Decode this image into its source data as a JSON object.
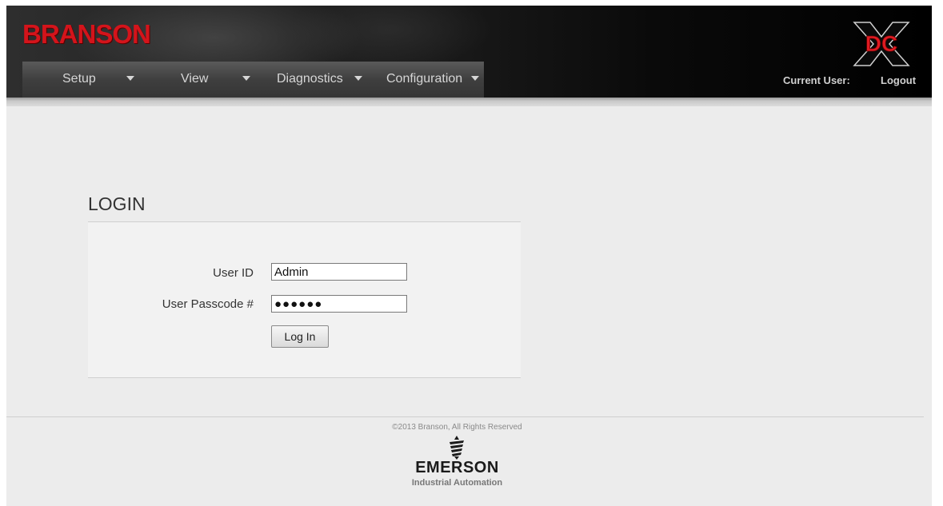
{
  "header": {
    "brand": "BRANSON",
    "logo_text": "DC",
    "nav": [
      {
        "label": "Setup"
      },
      {
        "label": "View"
      },
      {
        "label": "Diagnostics"
      },
      {
        "label": "Configuration"
      }
    ],
    "current_user_label": "Current User:",
    "logout_label": "Logout"
  },
  "login": {
    "title": "LOGIN",
    "user_id_label": "User ID",
    "user_id_value": "Admin",
    "passcode_label": "User Passcode #",
    "passcode_value": "●●●●●●",
    "button_label": "Log In"
  },
  "footer": {
    "copyright": "©2013 Branson, All Rights Reserved",
    "company": "EMERSON",
    "division": "Industrial Automation"
  },
  "colors": {
    "brand_red": "#d4141b",
    "header_bg": "#000000",
    "page_bg": "#ececec"
  }
}
